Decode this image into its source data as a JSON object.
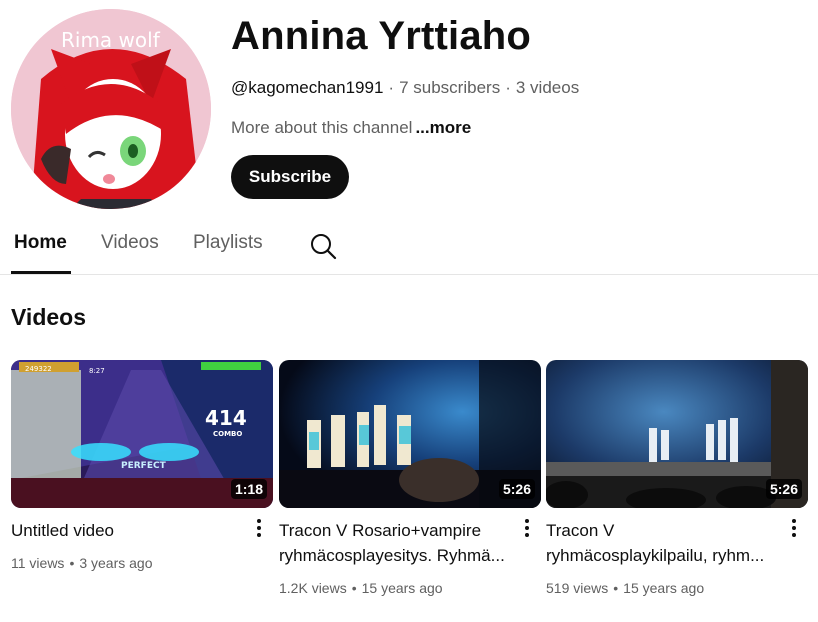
{
  "channel": {
    "avatar_watermark": "Rima wolf",
    "name": "Annina Yrttiaho",
    "handle": "@kagomechan1991",
    "subscribers": "7 subscribers",
    "video_count": "3 videos",
    "separator": "·",
    "about": "More about this channel",
    "more": "...more",
    "subscribe_label": "Subscribe"
  },
  "tabs": [
    {
      "label": "Home",
      "active": true
    },
    {
      "label": "Videos",
      "active": false
    },
    {
      "label": "Playlists",
      "active": false
    }
  ],
  "tab_icons": [
    "search-icon"
  ],
  "section": {
    "title": "Videos"
  },
  "videos": [
    {
      "title_line1": "Untitled video",
      "title_line2": "",
      "views": "11 views",
      "age": "3 years ago",
      "duration": "1:18",
      "thumb_text": [
        "249322",
        "8:27",
        "414",
        "COMBO",
        "PERFECT"
      ]
    },
    {
      "title_line1": "Tracon V Rosario+vampire",
      "title_line2": "ryhmäcosplayesitys. Ryhmä...",
      "views": "1.2K views",
      "age": "15 years ago",
      "duration": "5:26"
    },
    {
      "title_line1": "Tracon V",
      "title_line2": "ryhmäcosplaykilpailu, ryhm...",
      "views": "519 views",
      "age": "15 years ago",
      "duration": "5:26"
    }
  ],
  "colors": {
    "text": "#0f0f0f",
    "secondary": "#606060",
    "button_bg": "#0f0f0f",
    "divider": "#e5e5e5"
  }
}
